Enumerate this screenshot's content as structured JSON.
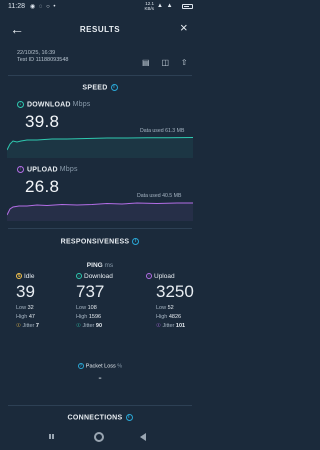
{
  "status_bar": {
    "time": "11:28",
    "network_rate": "12.1 KB/s",
    "battery_level": 0.5
  },
  "header": {
    "title": "RESULTS"
  },
  "test_info": {
    "datetime": "22/10/25, 16:39",
    "test_id": "Test ID 11188093548"
  },
  "speed": {
    "section_title": "SPEED",
    "download": {
      "label": "DOWNLOAD",
      "unit": "Mbps",
      "value": "39.8",
      "data_used": "Data used 61.3 MB",
      "color": "#2fc9b0"
    },
    "upload": {
      "label": "UPLOAD",
      "unit": "Mbps",
      "value": "26.8",
      "data_used": "Data used 40.5 MB",
      "color": "#b36ee6"
    }
  },
  "responsiveness": {
    "section_title": "RESPONSIVENESS",
    "ping_label": "PING",
    "ping_unit": "ms",
    "columns": [
      {
        "label": "Idle",
        "value": "39",
        "low_label": "Low",
        "low": "32",
        "high_label": "High",
        "high": "47",
        "jitter_label": "Jitter",
        "jitter": "7",
        "color": "#f2c14e"
      },
      {
        "label": "Download",
        "value": "737",
        "low_label": "Low",
        "low": "108",
        "high_label": "High",
        "high": "1596",
        "jitter_label": "Jitter",
        "jitter": "90",
        "color": "#2fc9b0"
      },
      {
        "label": "Upload",
        "value": "3250",
        "low_label": "Low",
        "low": "52",
        "high_label": "High",
        "high": "4826",
        "jitter_label": "Jitter",
        "jitter": "101",
        "color": "#b36ee6"
      }
    ],
    "packet_loss_label": "Packet Loss",
    "packet_loss_unit": "%",
    "packet_loss_value": "-"
  },
  "connections": {
    "section_title": "CONNECTIONS"
  },
  "colors": {
    "background": "#1b2a3b",
    "accent": "#2aa7d6"
  }
}
